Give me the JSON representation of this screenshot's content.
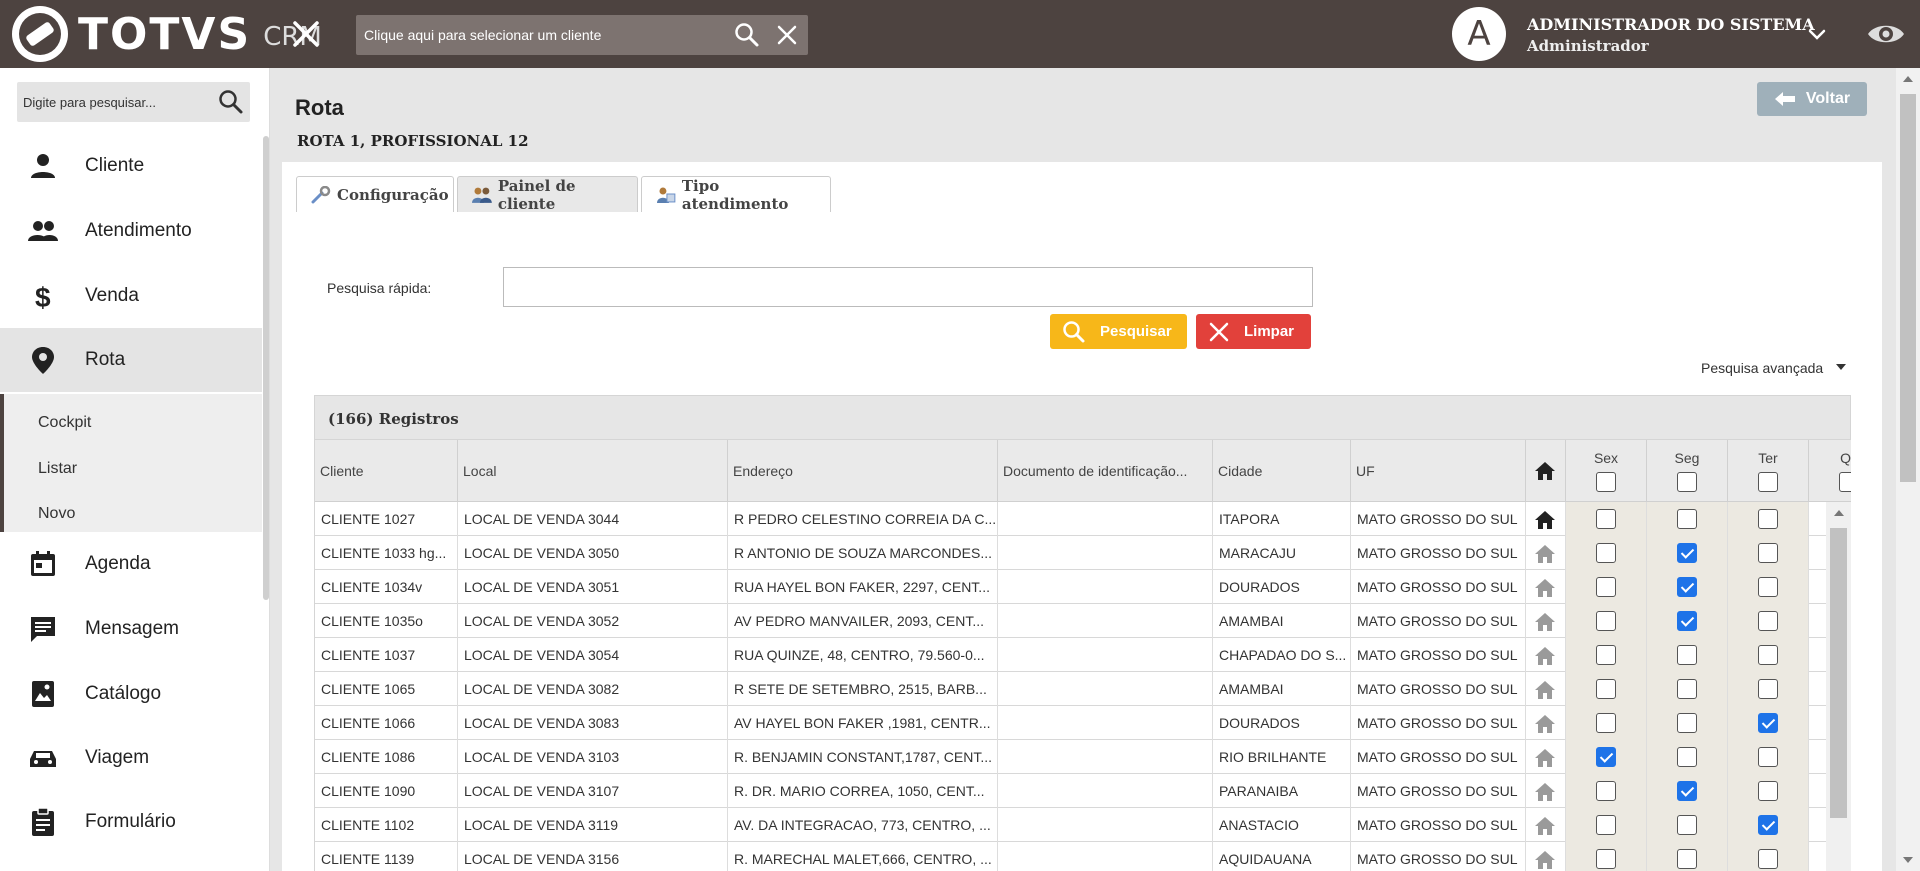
{
  "header": {
    "logo": "TOTVS",
    "logo_suffix": "CRM",
    "client_select_placeholder": "Clique aqui para selecionar um cliente",
    "avatar_letter": "A",
    "user_name": "ADMINISTRADOR DO SISTEMA",
    "user_role": "Administrador"
  },
  "sidebar": {
    "search_placeholder": "Digite para pesquisar...",
    "items": [
      {
        "label": "Cliente",
        "icon": "person-icon"
      },
      {
        "label": "Atendimento",
        "icon": "people-icon"
      },
      {
        "label": "Venda",
        "icon": "dollar-icon"
      },
      {
        "label": "Rota",
        "icon": "location-pin-icon"
      },
      {
        "label": "Agenda",
        "icon": "calendar-icon"
      },
      {
        "label": "Mensagem",
        "icon": "message-icon"
      },
      {
        "label": "Catálogo",
        "icon": "catalog-icon"
      },
      {
        "label": "Viagem",
        "icon": "car-icon"
      },
      {
        "label": "Formulário",
        "icon": "clipboard-icon"
      }
    ],
    "submenu": [
      "Cockpit",
      "Listar",
      "Novo"
    ]
  },
  "page": {
    "title": "Rota",
    "subtitle": "ROTA 1, PROFISSIONAL 12",
    "back_label": "Voltar"
  },
  "tabs": [
    {
      "label": "Configuração",
      "icon": "wrench-icon"
    },
    {
      "label": "Painel de cliente",
      "icon": "users-icon"
    },
    {
      "label": "Tipo atendimento",
      "icon": "service-icon"
    }
  ],
  "search": {
    "label": "Pesquisa rápida:",
    "value": "",
    "search_button": "Pesquisar",
    "clear_button": "Limpar",
    "advanced": "Pesquisa avançada"
  },
  "table": {
    "records_label": "(166) Registros",
    "columns": [
      "Cliente",
      "Local",
      "Endereço",
      "Documento de identificação...",
      "Cidade",
      "UF"
    ],
    "day_columns": [
      "Sex",
      "Seg",
      "Ter",
      "Qu"
    ],
    "rows": [
      {
        "cliente": "CLIENTE 1027",
        "local": "LOCAL DE VENDA 3044",
        "endereco": "R PEDRO CELESTINO CORREIA DA C...",
        "doc": "",
        "cidade": "ITAPORA",
        "uf": "MATO GROSSO DO SUL",
        "home_active": true,
        "sex": false,
        "seg": false,
        "ter": false
      },
      {
        "cliente": "CLIENTE 1033 hg...",
        "local": "LOCAL DE VENDA 3050",
        "endereco": "R ANTONIO DE SOUZA MARCONDES...",
        "doc": "",
        "cidade": "MARACAJU",
        "uf": "MATO GROSSO DO SUL",
        "home_active": false,
        "sex": false,
        "seg": true,
        "ter": false
      },
      {
        "cliente": "CLIENTE 1034v",
        "local": "LOCAL DE VENDA 3051",
        "endereco": "RUA HAYEL BON FAKER, 2297, CENT...",
        "doc": "",
        "cidade": "DOURADOS",
        "uf": "MATO GROSSO DO SUL",
        "home_active": false,
        "sex": false,
        "seg": true,
        "ter": false
      },
      {
        "cliente": "CLIENTE 1035o",
        "local": "LOCAL DE VENDA 3052",
        "endereco": "AV PEDRO MANVAILER, 2093, CENT...",
        "doc": "",
        "cidade": "AMAMBAI",
        "uf": "MATO GROSSO DO SUL",
        "home_active": false,
        "sex": false,
        "seg": true,
        "ter": false
      },
      {
        "cliente": "CLIENTE 1037",
        "local": "LOCAL DE VENDA 3054",
        "endereco": "RUA QUINZE, 48, CENTRO, 79.560-0...",
        "doc": "",
        "cidade": "CHAPADAO DO S...",
        "uf": "MATO GROSSO DO SUL",
        "home_active": false,
        "sex": false,
        "seg": false,
        "ter": false
      },
      {
        "cliente": "CLIENTE 1065",
        "local": "LOCAL DE VENDA 3082",
        "endereco": "R SETE DE SETEMBRO, 2515, BARB...",
        "doc": "",
        "cidade": "AMAMBAI",
        "uf": "MATO GROSSO DO SUL",
        "home_active": false,
        "sex": false,
        "seg": false,
        "ter": false
      },
      {
        "cliente": "CLIENTE 1066",
        "local": "LOCAL DE VENDA 3083",
        "endereco": "AV HAYEL BON FAKER ,1981, CENTR...",
        "doc": "",
        "cidade": "DOURADOS",
        "uf": "MATO GROSSO DO SUL",
        "home_active": false,
        "sex": false,
        "seg": false,
        "ter": true
      },
      {
        "cliente": "CLIENTE 1086",
        "local": "LOCAL DE VENDA 3103",
        "endereco": "R. BENJAMIN CONSTANT,1787, CENT...",
        "doc": "",
        "cidade": "RIO BRILHANTE",
        "uf": "MATO GROSSO DO SUL",
        "home_active": false,
        "sex": true,
        "seg": false,
        "ter": false
      },
      {
        "cliente": "CLIENTE 1090",
        "local": "LOCAL DE VENDA 3107",
        "endereco": "R. DR. MARIO CORREA, 1050, CENT...",
        "doc": "",
        "cidade": "PARANAIBA",
        "uf": "MATO GROSSO DO SUL",
        "home_active": false,
        "sex": false,
        "seg": true,
        "ter": false
      },
      {
        "cliente": "CLIENTE 1102",
        "local": "LOCAL DE VENDA 3119",
        "endereco": "AV. DA INTEGRACAO, 773, CENTRO, ...",
        "doc": "",
        "cidade": "ANASTACIO",
        "uf": "MATO GROSSO DO SUL",
        "home_active": false,
        "sex": false,
        "seg": false,
        "ter": true
      },
      {
        "cliente": "CLIENTE 1139",
        "local": "LOCAL DE VENDA 3156",
        "endereco": "R. MARECHAL MALET,666, CENTRO, ...",
        "doc": "",
        "cidade": "AQUIDAUANA",
        "uf": "MATO GROSSO DO SUL",
        "home_active": false,
        "sex": false,
        "seg": false,
        "ter": false
      }
    ]
  },
  "colors": {
    "topbar": "#4d4340",
    "search_button": "#f7b719",
    "clear_button": "#e2413b",
    "checkbox_checked": "#1e73e8",
    "back_button": "#9fb0ba"
  }
}
